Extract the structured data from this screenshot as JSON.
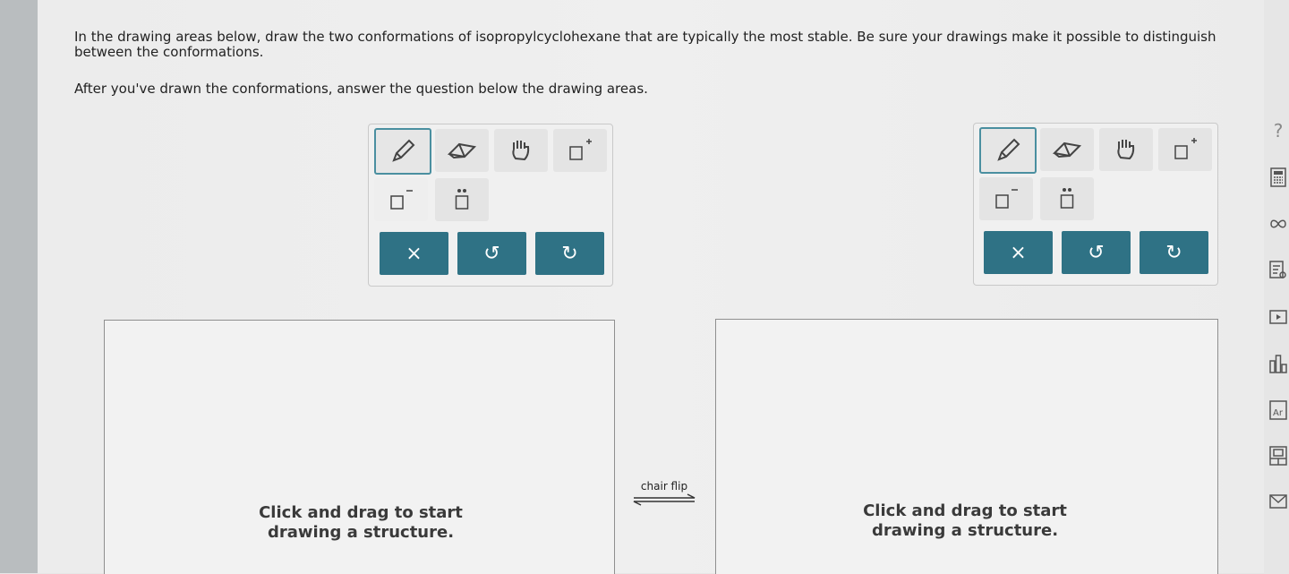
{
  "prompt": {
    "line1": "In the drawing areas below, draw the two conformations of isopropylcyclohexane that are typically the most stable. Be sure your drawings make it possible to distinguish between the conformations.",
    "line2": "After you've drawn the conformations, answer the question below the drawing areas."
  },
  "toolbar": {
    "tools": [
      "pencil-icon",
      "eraser-icon",
      "hand-icon",
      "add-positive-charge-icon",
      "add-negative-charge-icon",
      "lone-pair-icon"
    ],
    "clear_label": "×",
    "undo_label": "↺",
    "redo_label": "↻",
    "accent": "#2f7285"
  },
  "canvas": {
    "hint_line1": "Click and drag to start",
    "hint_line2": "drawing a structure."
  },
  "equilibrium": {
    "label": "chair flip"
  },
  "sidebar": {
    "help_label": "?",
    "icons": [
      "calculator-icon",
      "infinity-icon",
      "explanation-icon",
      "video-icon",
      "chart-icon",
      "periodic-table-icon",
      "data-icon",
      "mail-icon"
    ]
  }
}
